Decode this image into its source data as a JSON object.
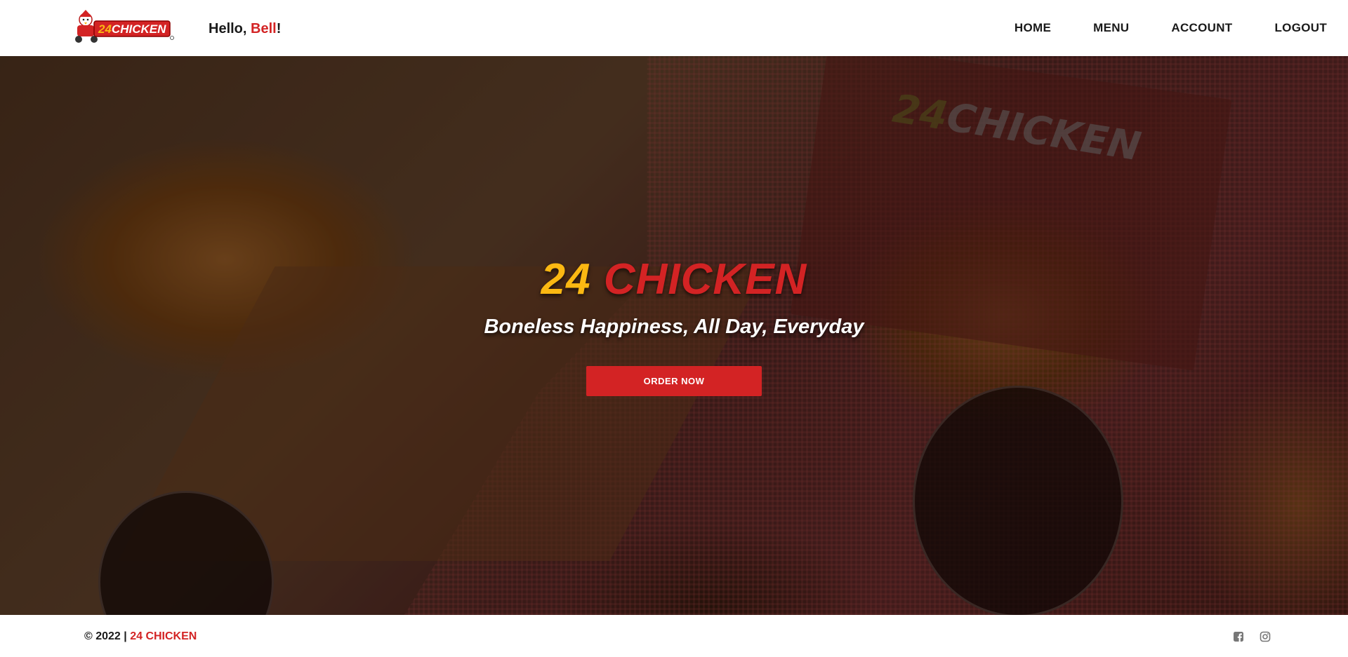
{
  "header": {
    "logo_text": "24CHICKEN",
    "greeting_prefix": "Hello,",
    "greeting_name": "Bell",
    "greeting_suffix": "!",
    "nav": [
      "HOME",
      "MENU",
      "ACCOUNT",
      "LOGOUT"
    ]
  },
  "hero": {
    "brand_number": "24",
    "brand_word": "CHICKEN",
    "box_label_number": "24",
    "box_label_word": "CHICKEN",
    "tagline": "Boneless Happiness, All Day, Everyday",
    "cta_label": "ORDER NOW"
  },
  "footer": {
    "copyright_prefix": "© 2022 |",
    "copyright_brand": "24 CHICKEN",
    "social_icons": [
      "facebook-icon",
      "instagram-icon"
    ]
  },
  "colors": {
    "brand_red": "#d32324",
    "brand_yellow": "#fbb812",
    "text_dark": "#1a1a1a"
  }
}
